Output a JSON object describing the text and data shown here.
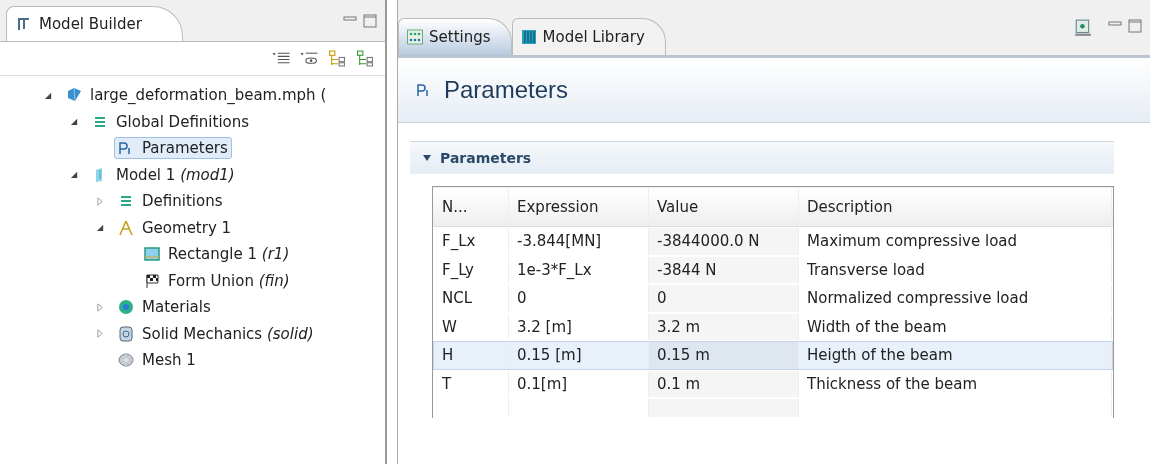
{
  "left_panel": {
    "tab": "Model Builder",
    "tree": [
      {
        "label": "large_deformation_beam.mph (",
        "kind": "file",
        "expanded": true,
        "selected": false,
        "children": [
          {
            "label": "Global Definitions",
            "kind": "definitions",
            "expanded": true,
            "selected": false,
            "children": [
              {
                "label": "Parameters",
                "kind": "parameter",
                "selected": true
              }
            ]
          },
          {
            "label": "Model 1 *(mod1)*",
            "kind": "model",
            "expanded": true,
            "selected": false,
            "children": [
              {
                "label": "Definitions",
                "kind": "definitions",
                "expanded": false,
                "selected": false
              },
              {
                "label": "Geometry 1",
                "kind": "geometry",
                "expanded": true,
                "selected": false,
                "children": [
                  {
                    "label": "Rectangle 1 *(r1)*",
                    "kind": "rectangle",
                    "selected": false
                  },
                  {
                    "label": "Form Union *(fin)*",
                    "kind": "form-union",
                    "selected": false
                  }
                ]
              },
              {
                "label": "Materials",
                "kind": "materials",
                "expanded": false,
                "selected": false
              },
              {
                "label": "Solid Mechanics *(solid)*",
                "kind": "physics",
                "expanded": false,
                "selected": false
              },
              {
                "label": "Mesh 1",
                "kind": "mesh",
                "selected": false
              }
            ]
          }
        ]
      }
    ]
  },
  "right_panel": {
    "tabs": [
      {
        "label": "Settings",
        "kind": "settings",
        "selected": true
      },
      {
        "label": "Model Library",
        "kind": "library",
        "selected": false
      }
    ],
    "title": "Parameters",
    "section": {
      "label": "Parameters",
      "expanded": true
    },
    "table": {
      "columns": [
        "N...",
        "Expression",
        "Value",
        "Description"
      ],
      "rows": [
        {
          "cells": [
            "F_Lx",
            "-3.844[MN]",
            "-3844000.0 N",
            "Maximum compressive load"
          ],
          "selected": false
        },
        {
          "cells": [
            "F_Ly",
            "1e-3*F_Lx",
            "-3844 N",
            "Transverse load"
          ],
          "selected": false
        },
        {
          "cells": [
            "NCL",
            "0",
            "0",
            "Normalized compressive load"
          ],
          "selected": false
        },
        {
          "cells": [
            "W",
            "3.2 [m]",
            "3.2 m",
            "Width of the beam"
          ],
          "selected": false
        },
        {
          "cells": [
            "H",
            "0.15 [m]",
            "0.15 m",
            "Heigth of the beam"
          ],
          "selected": true
        },
        {
          "cells": [
            "T",
            "0.1[m]",
            "0.1 m",
            "Thickness of the beam"
          ],
          "selected": false
        }
      ]
    }
  }
}
